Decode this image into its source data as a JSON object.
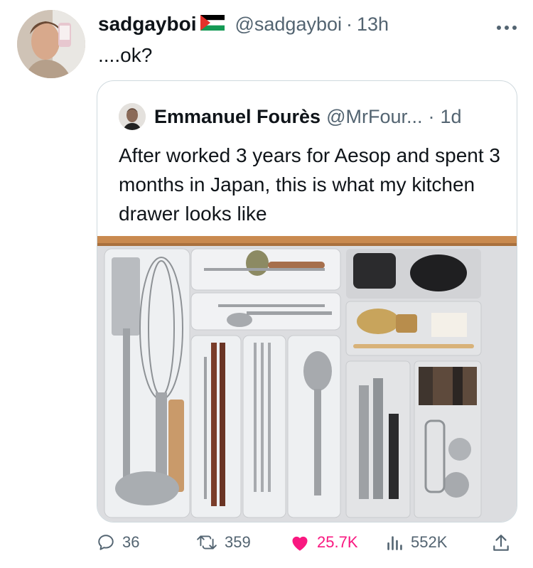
{
  "tweet": {
    "display_name": "sadgayboi",
    "handle": "@sadgayboi",
    "separator": "·",
    "time": "13h",
    "text": "....ok?"
  },
  "quoted": {
    "display_name": "Emmanuel Fourès",
    "handle": "@MrFour...",
    "separator": "·",
    "time": "1d",
    "text": "After worked 3 years for Aesop and spent 3 months in Japan, this is what my kitchen drawer looks like"
  },
  "actions": {
    "replies": "36",
    "retweets": "359",
    "likes": "25.7K",
    "views": "552K"
  },
  "colors": {
    "like": "#f91880",
    "muted": "#536471",
    "text": "#0f1419"
  },
  "icons": [
    "more-icon",
    "reply-icon",
    "retweet-icon",
    "heart-icon",
    "views-icon",
    "share-icon",
    "flag-icon"
  ]
}
